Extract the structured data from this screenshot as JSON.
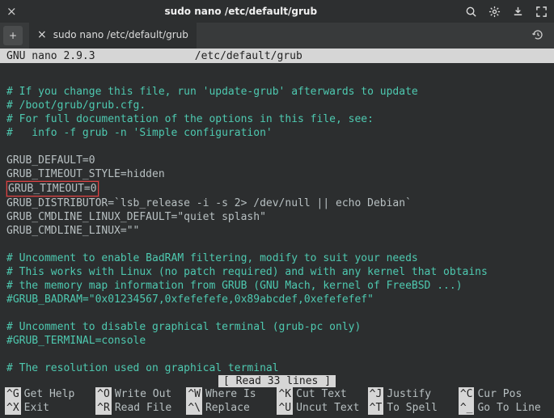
{
  "titlebar": {
    "close_icon": "×",
    "title": "sudo nano /etc/default/grub"
  },
  "tabbar": {
    "newtab": "+",
    "tab_close": "×",
    "tab_label": "sudo nano /etc/default/grub"
  },
  "status": {
    "app": "GNU nano 2.9.3",
    "file": "/etc/default/grub"
  },
  "content": {
    "c1": "# If you change this file, run 'update-grub' afterwards to update",
    "c2": "# /boot/grub/grub.cfg.",
    "c3": "# For full documentation of the options in this file, see:",
    "c4": "#   info -f grub -n 'Simple configuration'",
    "l6": "GRUB_DEFAULT=0",
    "l7": "GRUB_TIMEOUT_STYLE=hidden",
    "l8": "GRUB_TIMEOUT=0",
    "l9": "GRUB_DISTRIBUTOR=`lsb_release -i -s 2> /dev/null || echo Debian`",
    "l10": "GRUB_CMDLINE_LINUX_DEFAULT=\"quiet splash\"",
    "l11": "GRUB_CMDLINE_LINUX=\"\"",
    "c13": "# Uncomment to enable BadRAM filtering, modify to suit your needs",
    "c14": "# This works with Linux (no patch required) and with any kernel that obtains",
    "c15": "# the memory map information from GRUB (GNU Mach, kernel of FreeBSD ...)",
    "c16": "#GRUB_BADRAM=\"0x01234567,0xfefefefe,0x89abcdef,0xefefefef\"",
    "c18": "# Uncomment to disable graphical terminal (grub-pc only)",
    "c19": "#GRUB_TERMINAL=console",
    "c21": "# The resolution used on graphical terminal"
  },
  "readline": "[ Read 33 lines ]",
  "shortcuts": {
    "r1": [
      {
        "k": "^G",
        "l": "Get Help"
      },
      {
        "k": "^O",
        "l": "Write Out"
      },
      {
        "k": "^W",
        "l": "Where Is"
      },
      {
        "k": "^K",
        "l": "Cut Text"
      },
      {
        "k": "^J",
        "l": "Justify"
      },
      {
        "k": "^C",
        "l": "Cur Pos"
      }
    ],
    "r2": [
      {
        "k": "^X",
        "l": "Exit"
      },
      {
        "k": "^R",
        "l": "Read File"
      },
      {
        "k": "^\\",
        "l": "Replace"
      },
      {
        "k": "^U",
        "l": "Uncut Text"
      },
      {
        "k": "^T",
        "l": "To Spell"
      },
      {
        "k": "^_",
        "l": "Go To Line"
      }
    ]
  }
}
